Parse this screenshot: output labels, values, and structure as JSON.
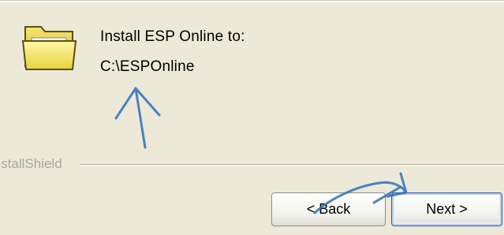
{
  "install": {
    "label": "Install ESP Online to:",
    "path": "C:\\ESPOnline"
  },
  "icons": {
    "folder": "folder-icon"
  },
  "footer": {
    "brand": "InstallShield"
  },
  "buttons": {
    "back": "< Back",
    "next": "Next >"
  },
  "colors": {
    "dialog_bg": "#ECE9D8",
    "annotation": "#2F6FB7",
    "focus_border": "#3B5F9F"
  }
}
